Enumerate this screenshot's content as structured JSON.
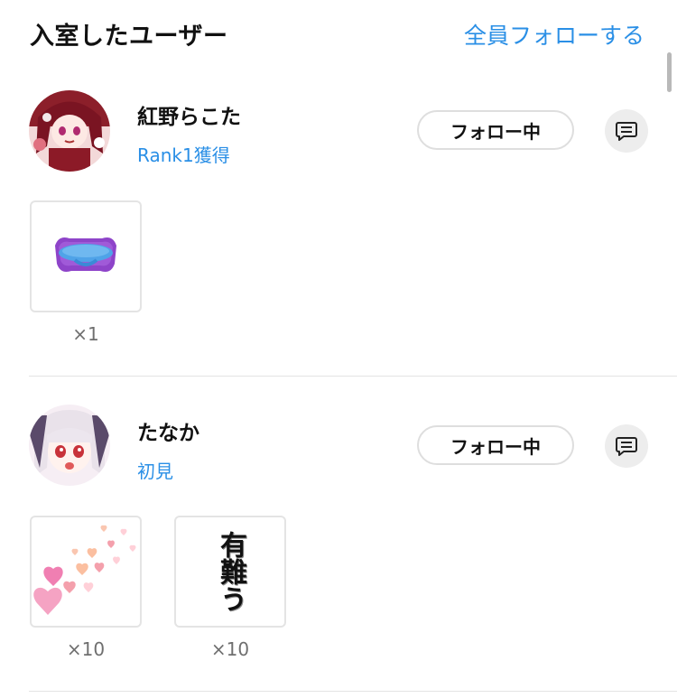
{
  "header": {
    "title": "入室したユーザー",
    "follow_all": "全員フォローする"
  },
  "colors": {
    "accent": "#2a8fe6",
    "chat_button_bg": "#ededed",
    "divider": "#e3e3e3"
  },
  "users": [
    {
      "name": "紅野らこた",
      "badge": "Rank1獲得",
      "follow_label": "フォロー中",
      "gifts": [
        {
          "icon": "pacifier-icon",
          "count": "×1"
        }
      ]
    },
    {
      "name": "たなか",
      "badge": "初見",
      "follow_label": "フォロー中",
      "gifts": [
        {
          "icon": "hearts-icon",
          "count": "×10"
        },
        {
          "icon": "arigatou-calligraphy-icon",
          "text": "有難う",
          "count": "×10"
        }
      ]
    }
  ]
}
